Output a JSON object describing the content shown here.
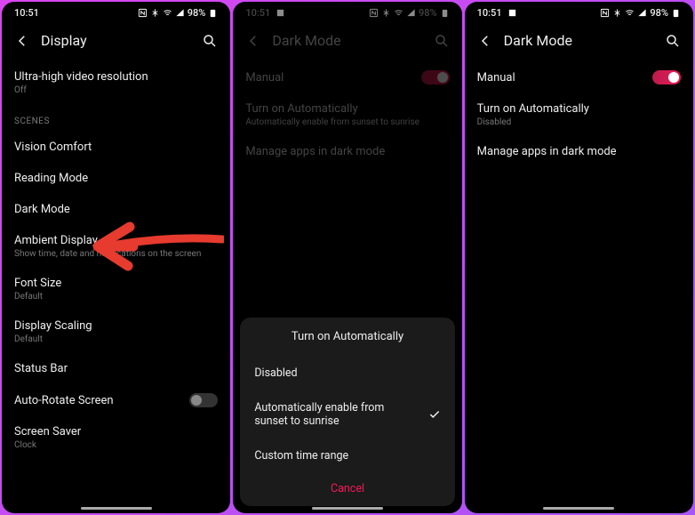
{
  "statusbar": {
    "time": "10:51",
    "battery": "98%"
  },
  "screen1": {
    "title": "Display",
    "ultra": {
      "label": "Ultra-high video resolution",
      "sub": "Off"
    },
    "scenesLabel": "SCENES",
    "vision": "Vision Comfort",
    "reading": "Reading Mode",
    "dark": "Dark Mode",
    "ambient": {
      "label": "Ambient Display",
      "sub": "Show time, date and notifications on the screen"
    },
    "font": {
      "label": "Font Size",
      "sub": "Default"
    },
    "scaling": {
      "label": "Display Scaling",
      "sub": "Default"
    },
    "statusBar": "Status Bar",
    "autorotate": "Auto-Rotate Screen",
    "saver": {
      "label": "Screen Saver",
      "sub": "Clock"
    }
  },
  "screen2": {
    "title": "Dark Mode",
    "manual": "Manual",
    "auto": {
      "label": "Turn on Automatically",
      "sub": "Automatically enable from sunset to sunrise"
    },
    "manage": "Manage apps in dark mode",
    "sheet": {
      "title": "Turn on Automatically",
      "opt1": "Disabled",
      "opt2": "Automatically enable from sunset to sunrise",
      "opt3": "Custom time range",
      "cancel": "Cancel"
    }
  },
  "screen3": {
    "title": "Dark Mode",
    "manual": "Manual",
    "auto": {
      "label": "Turn on Automatically",
      "sub": "Disabled"
    },
    "manage": "Manage apps in dark mode"
  }
}
